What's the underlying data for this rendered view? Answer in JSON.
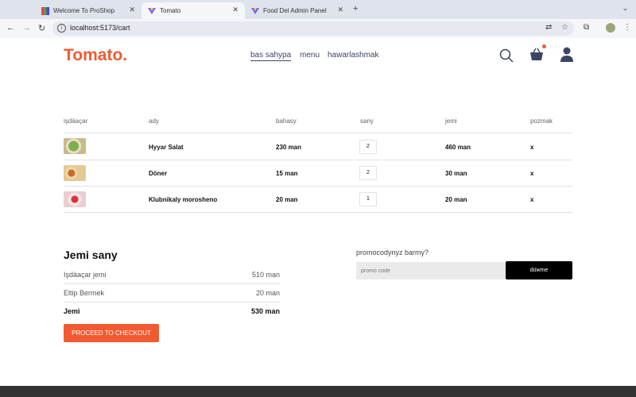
{
  "browser": {
    "tabs": [
      {
        "title": "Welcome To ProShop",
        "active": false
      },
      {
        "title": "Tomato",
        "active": true
      },
      {
        "title": "Food Del Admin Panel",
        "active": false
      }
    ],
    "url": "localhost:5173/cart"
  },
  "site": {
    "logo": "Tomato.",
    "nav": [
      "bas sahypa",
      "menu",
      "hawarlashmak"
    ],
    "colors": {
      "accent": "#f15a30",
      "text": "#3d4566"
    }
  },
  "cart": {
    "headers": [
      "işdäaçar",
      "ady",
      "bahasy",
      "sany",
      "jemi",
      "pozmak"
    ],
    "rows": [
      {
        "name": "Hyyar Salat",
        "price": "230 man",
        "qty": "2",
        "total": "460 man",
        "remove": "x"
      },
      {
        "name": "Döner",
        "price": "15 man",
        "qty": "2",
        "total": "30 man",
        "remove": "x"
      },
      {
        "name": "Klubnikaly morosheno",
        "price": "20 man",
        "qty": "1",
        "total": "20 man",
        "remove": "x"
      }
    ]
  },
  "totals": {
    "title": "Jemi sany",
    "subtotal_label": "Işdäaçar jemi",
    "subtotal_value": "510 man",
    "delivery_label": "Eltip Bermek",
    "delivery_value": "20 man",
    "total_label": "Jemi",
    "total_value": "530 man",
    "checkout_label": "PROCEED TO CHECKOUT"
  },
  "promo": {
    "label": "promocodynyz barmy?",
    "placeholder": "promo code",
    "button": "düwme"
  }
}
